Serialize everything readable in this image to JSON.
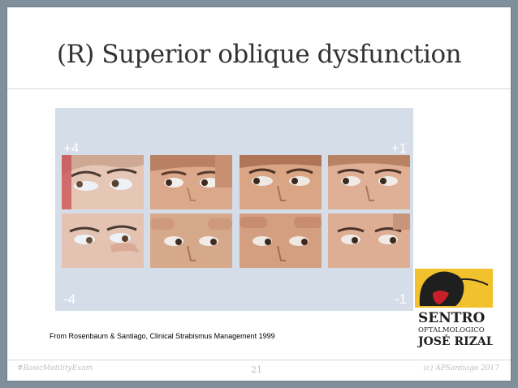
{
  "slide": {
    "title": "(R) Superior oblique dysfunction",
    "labels": {
      "top_left": "+4",
      "top_right": "+1",
      "bottom_left": "-4",
      "bottom_right": "-1"
    },
    "caption": "From Rosenbaum & Santiago, Clinical Strabismus Management 1999",
    "footer": {
      "left": "#BasicMotilityExam",
      "center": "21",
      "right": "(c) APSantiago 2017"
    }
  },
  "logo": {
    "line1": "SENTRO",
    "line2": "OFTALMOLOGICO",
    "line3": "JOSÉ RIZAL",
    "colors": {
      "yellow": "#f2c12e",
      "red": "#c8202a",
      "dark": "#1f1f1f"
    }
  },
  "photos": [
    {
      "row": 1,
      "name": "photo-plus4-top"
    },
    {
      "row": 1,
      "name": "photo-plus3-top"
    },
    {
      "row": 1,
      "name": "photo-plus2-top"
    },
    {
      "row": 1,
      "name": "photo-plus1-top"
    },
    {
      "row": 2,
      "name": "photo-minus4-bottom"
    },
    {
      "row": 2,
      "name": "photo-minus3-bottom"
    },
    {
      "row": 2,
      "name": "photo-minus2-bottom"
    },
    {
      "row": 2,
      "name": "photo-minus1-bottom"
    }
  ]
}
